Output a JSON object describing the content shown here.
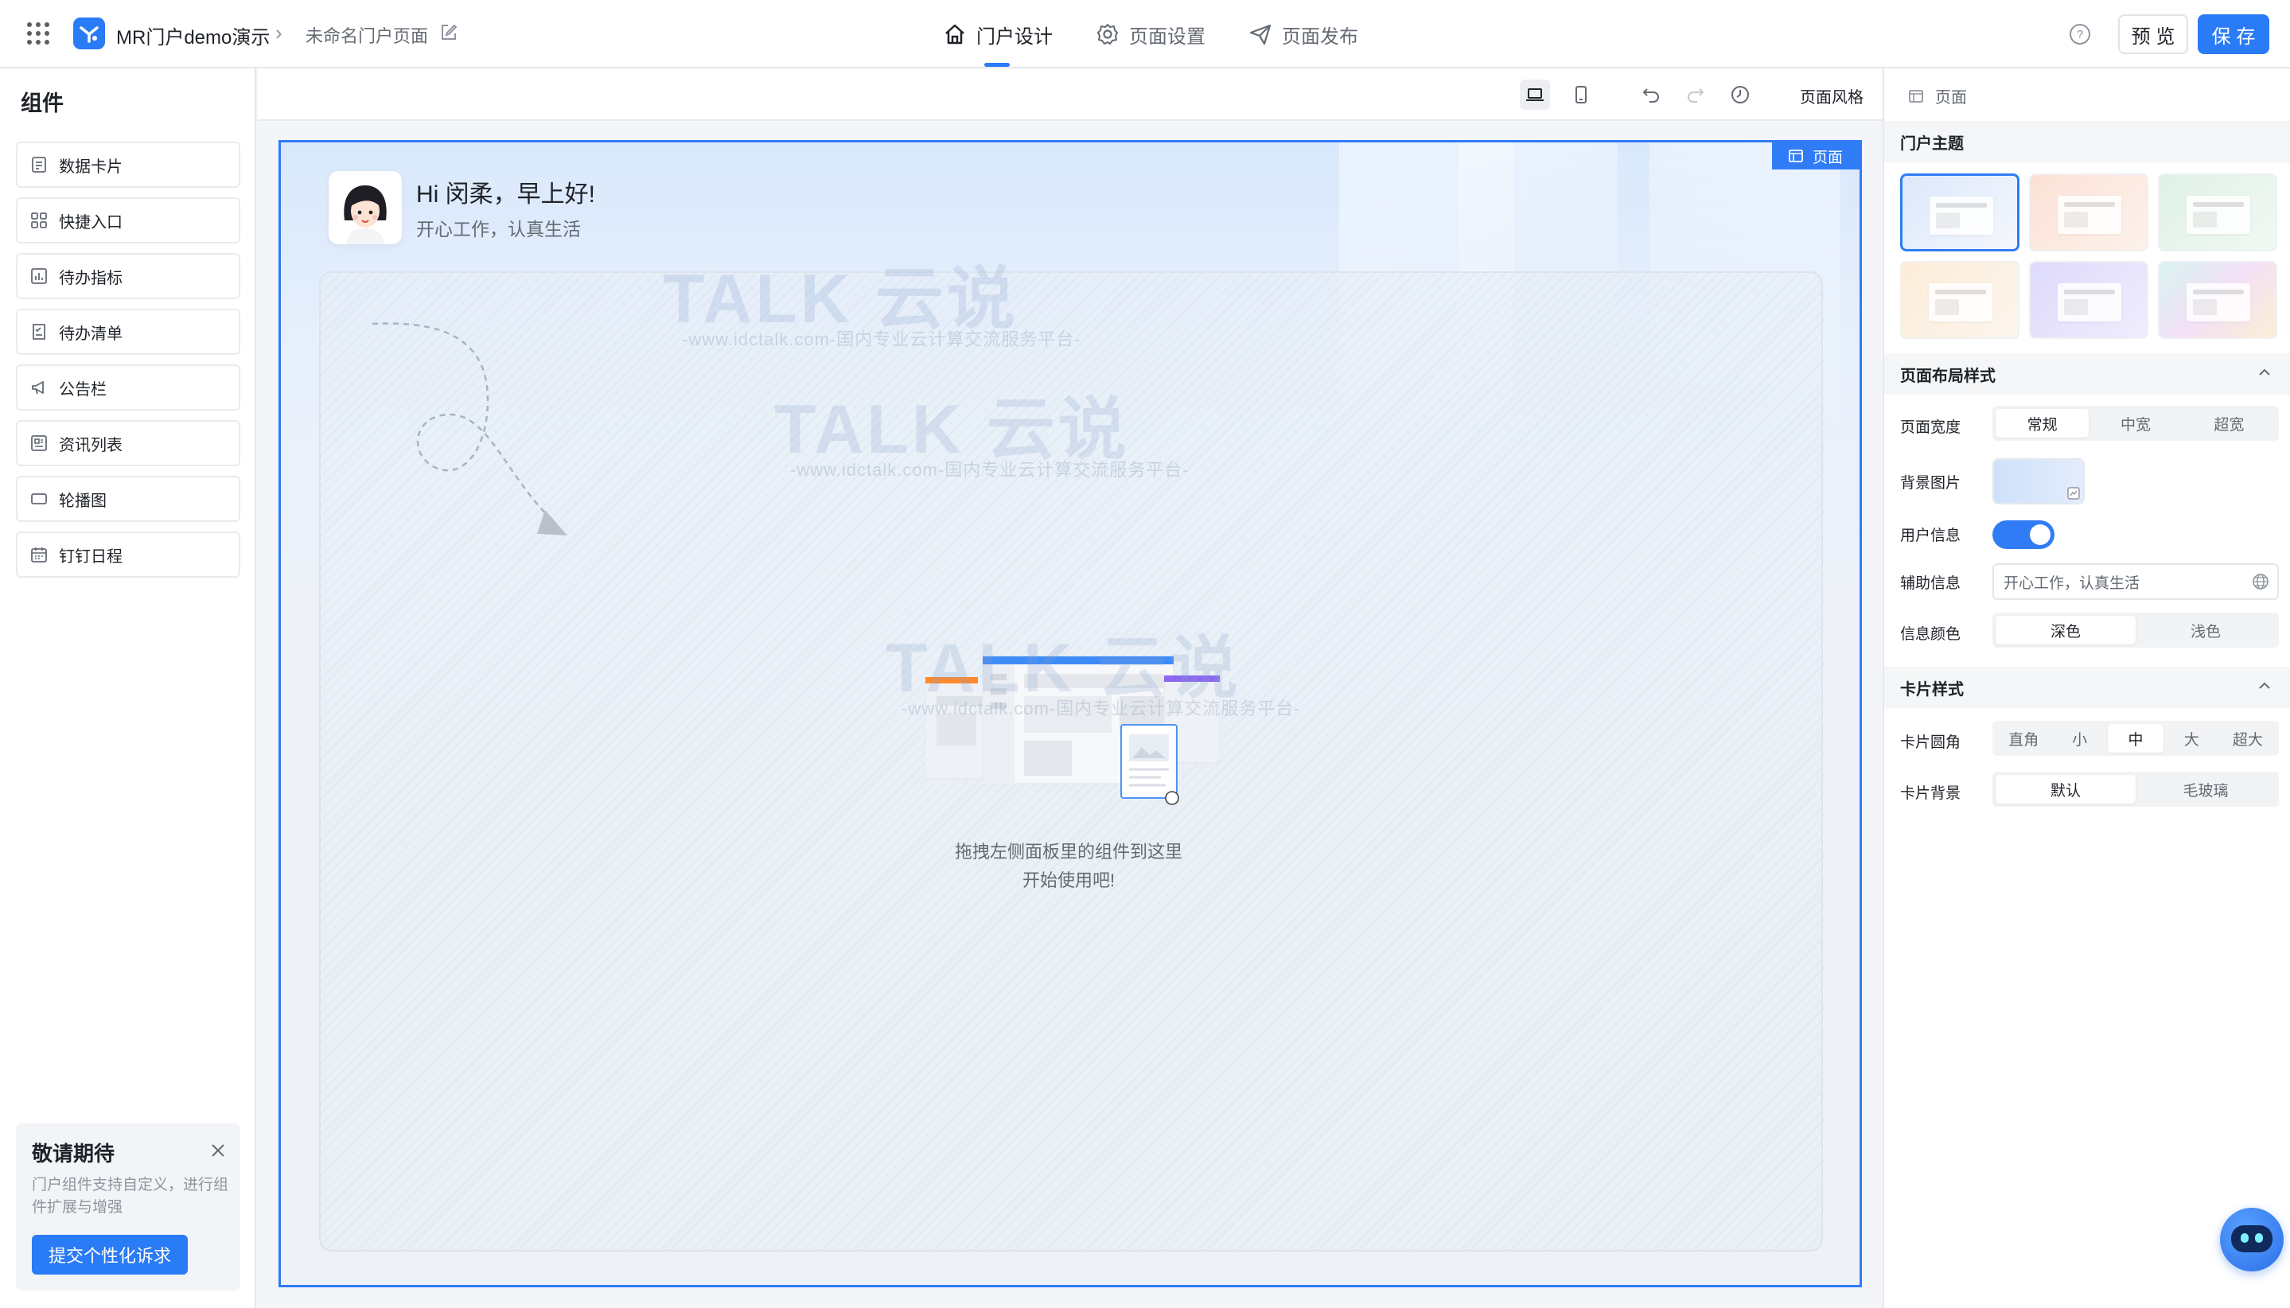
{
  "header": {
    "app_name": "MR门户demo演示",
    "page_name": "未命名门户页面",
    "tabs": [
      {
        "label": "门户设计",
        "icon": "home-icon",
        "active": true
      },
      {
        "label": "页面设置",
        "icon": "gear-icon",
        "active": false
      },
      {
        "label": "页面发布",
        "icon": "send-icon",
        "active": false
      }
    ],
    "preview_label": "预 览",
    "save_label": "保 存",
    "accent_color": "#2a7bf6"
  },
  "left_panel": {
    "title": "组件",
    "components": [
      {
        "label": "数据卡片",
        "icon": "data-card-icon"
      },
      {
        "label": "快捷入口",
        "icon": "grid-icon"
      },
      {
        "label": "待办指标",
        "icon": "chart-icon"
      },
      {
        "label": "待办清单",
        "icon": "checklist-icon"
      },
      {
        "label": "公告栏",
        "icon": "megaphone-icon"
      },
      {
        "label": "资讯列表",
        "icon": "news-icon"
      },
      {
        "label": "轮播图",
        "icon": "carousel-icon"
      },
      {
        "label": "钉钉日程",
        "icon": "calendar-icon"
      }
    ],
    "promo": {
      "title": "敬请期待",
      "desc": "门户组件支持自定义，进行组件扩展与增强",
      "button": "提交个性化诉求"
    }
  },
  "toolbar": {
    "style_label": "页面风格"
  },
  "canvas": {
    "page_tag": "页面",
    "greeting": "Hi 闵柔，早上好!",
    "subtitle": "开心工作，认真生活",
    "empty_line1": "拖拽左侧面板里的组件到这里",
    "empty_line2": "开始使用吧!",
    "watermark_text": "TALK 云说",
    "watermark_sub": "-www.idctalk.com-国内专业云计算交流服务平台-"
  },
  "right_panel": {
    "head": "页面",
    "theme_title": "门户主题",
    "themes": [
      {
        "color": "#dde8fb",
        "selected": true
      },
      {
        "color": "#fbe1d6",
        "selected": false
      },
      {
        "color": "#dff1e6",
        "selected": false
      },
      {
        "color": "#fcecd8",
        "selected": false
      },
      {
        "color": "#dedafc",
        "selected": false
      },
      {
        "color": "#f3e0f6",
        "selected": false
      }
    ],
    "layout_title": "页面布局样式",
    "width_label": "页面宽度",
    "width_options": [
      "常规",
      "中宽",
      "超宽"
    ],
    "width_selected": "常规",
    "bg_label": "背景图片",
    "user_info_label": "用户信息",
    "user_info_on": true,
    "aux_label": "辅助信息",
    "aux_value": "开心工作，认真生活",
    "color_label": "信息颜色",
    "color_options": [
      "深色",
      "浅色"
    ],
    "color_selected": "深色",
    "card_title": "卡片样式",
    "radius_label": "卡片圆角",
    "radius_options": [
      "直角",
      "小",
      "中",
      "大",
      "超大"
    ],
    "radius_selected": "中",
    "card_bg_label": "卡片背景",
    "card_bg_options": [
      "默认",
      "毛玻璃"
    ],
    "card_bg_selected": "默认"
  }
}
